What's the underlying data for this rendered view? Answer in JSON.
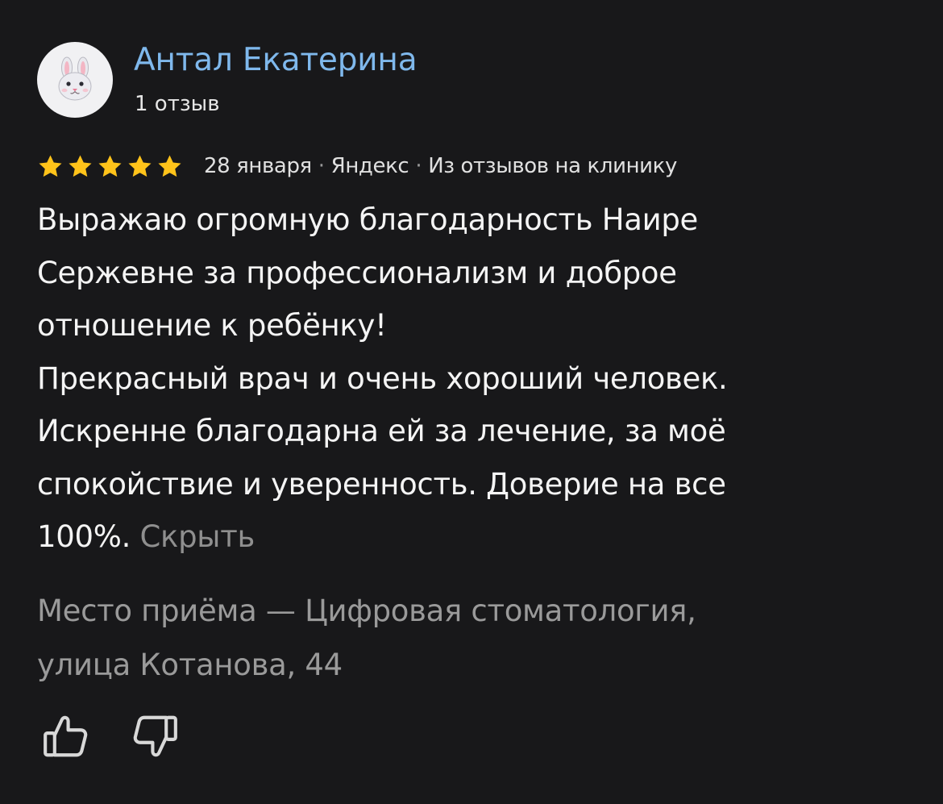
{
  "author": {
    "name": "Антал Екатерина",
    "reviews_count": "1 отзыв",
    "avatar_icon": "rabbit-face-icon"
  },
  "rating": {
    "stars": 5,
    "max_stars": 5,
    "star_color": "#ffc31a"
  },
  "meta": {
    "date": "28 января",
    "separator": "·",
    "source": "Яндекс",
    "origin": "Из отзывов на клинику"
  },
  "review": {
    "lines": [
      "Выражаю огромную благодарность Наире",
      "Сержевне за профессионализм и доброе",
      "отношение к ребёнку!",
      "Прекрасный врач и очень хороший человек.",
      "Искренне благодарна ей за лечение, за моё",
      "спокойствие и уверенность. Доверие на все",
      "100%."
    ],
    "hide_label": "Скрыть"
  },
  "place": {
    "lines": [
      "Место приёма — Цифровая стоматология,",
      "улица Котанова, 44"
    ]
  },
  "reactions": {
    "like_icon": "thumbs-up-icon",
    "dislike_icon": "thumbs-down-icon"
  },
  "colors": {
    "background": "#18181a",
    "author_link": "#7fb8ec",
    "muted_text": "#9a9a9a"
  }
}
